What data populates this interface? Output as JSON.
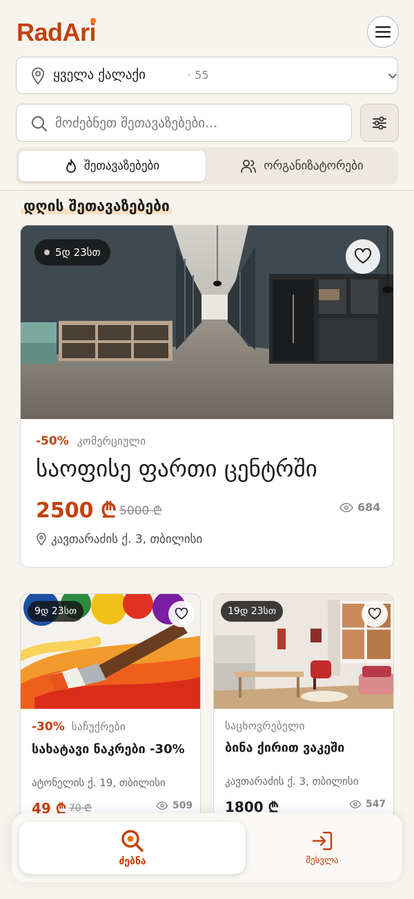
{
  "app": {
    "logo": "RadAri"
  },
  "colors": {
    "accent": "#c2410c",
    "background": "#f7f4ef"
  },
  "city_selector": {
    "name": "ყველა ქალაქი",
    "count": "· 55",
    "icon": "map-pin-icon"
  },
  "search": {
    "placeholder": "მოძებნეთ შეთავაზებები...",
    "value": ""
  },
  "tabs": [
    {
      "label": "შეთავაზებები",
      "icon": "flame-icon",
      "active": true
    },
    {
      "label": "ორგანიზატორები",
      "icon": "users-icon",
      "active": false
    }
  ],
  "section": {
    "title": "დღის შეთავაზებები"
  },
  "featured": {
    "timer": "5დ 23სთ",
    "discount": "-50%",
    "category": "კომერციული",
    "title": "საოფისე ფართი ცენტრში",
    "price": "2500 ₾",
    "old_price": "5000 ₾",
    "views": "684",
    "address": "კავთარაძის ქ. 3, თბილისი"
  },
  "offers": [
    {
      "timer": "9დ 23სთ",
      "discount": "-30%",
      "category": "საჩუქრები",
      "title": "სახატავი ნაკრები -30%",
      "address": "ატონელის ქ. 19, თბილისი",
      "price": "49 ₾",
      "old_price": "70 ₾",
      "views": "509"
    },
    {
      "timer": "19დ 23სთ",
      "category": "საცხოვრებელი",
      "title": "ბინა ქირით ვაკეში",
      "address": "კავთარაძის ქ. 3, თბილისი",
      "price": "1800 ₾",
      "views": "547"
    }
  ],
  "bottom_nav": [
    {
      "label": "ძებნა",
      "icon": "search-icon",
      "active": true
    },
    {
      "label": "შესვლა",
      "icon": "login-icon",
      "active": false
    }
  ]
}
